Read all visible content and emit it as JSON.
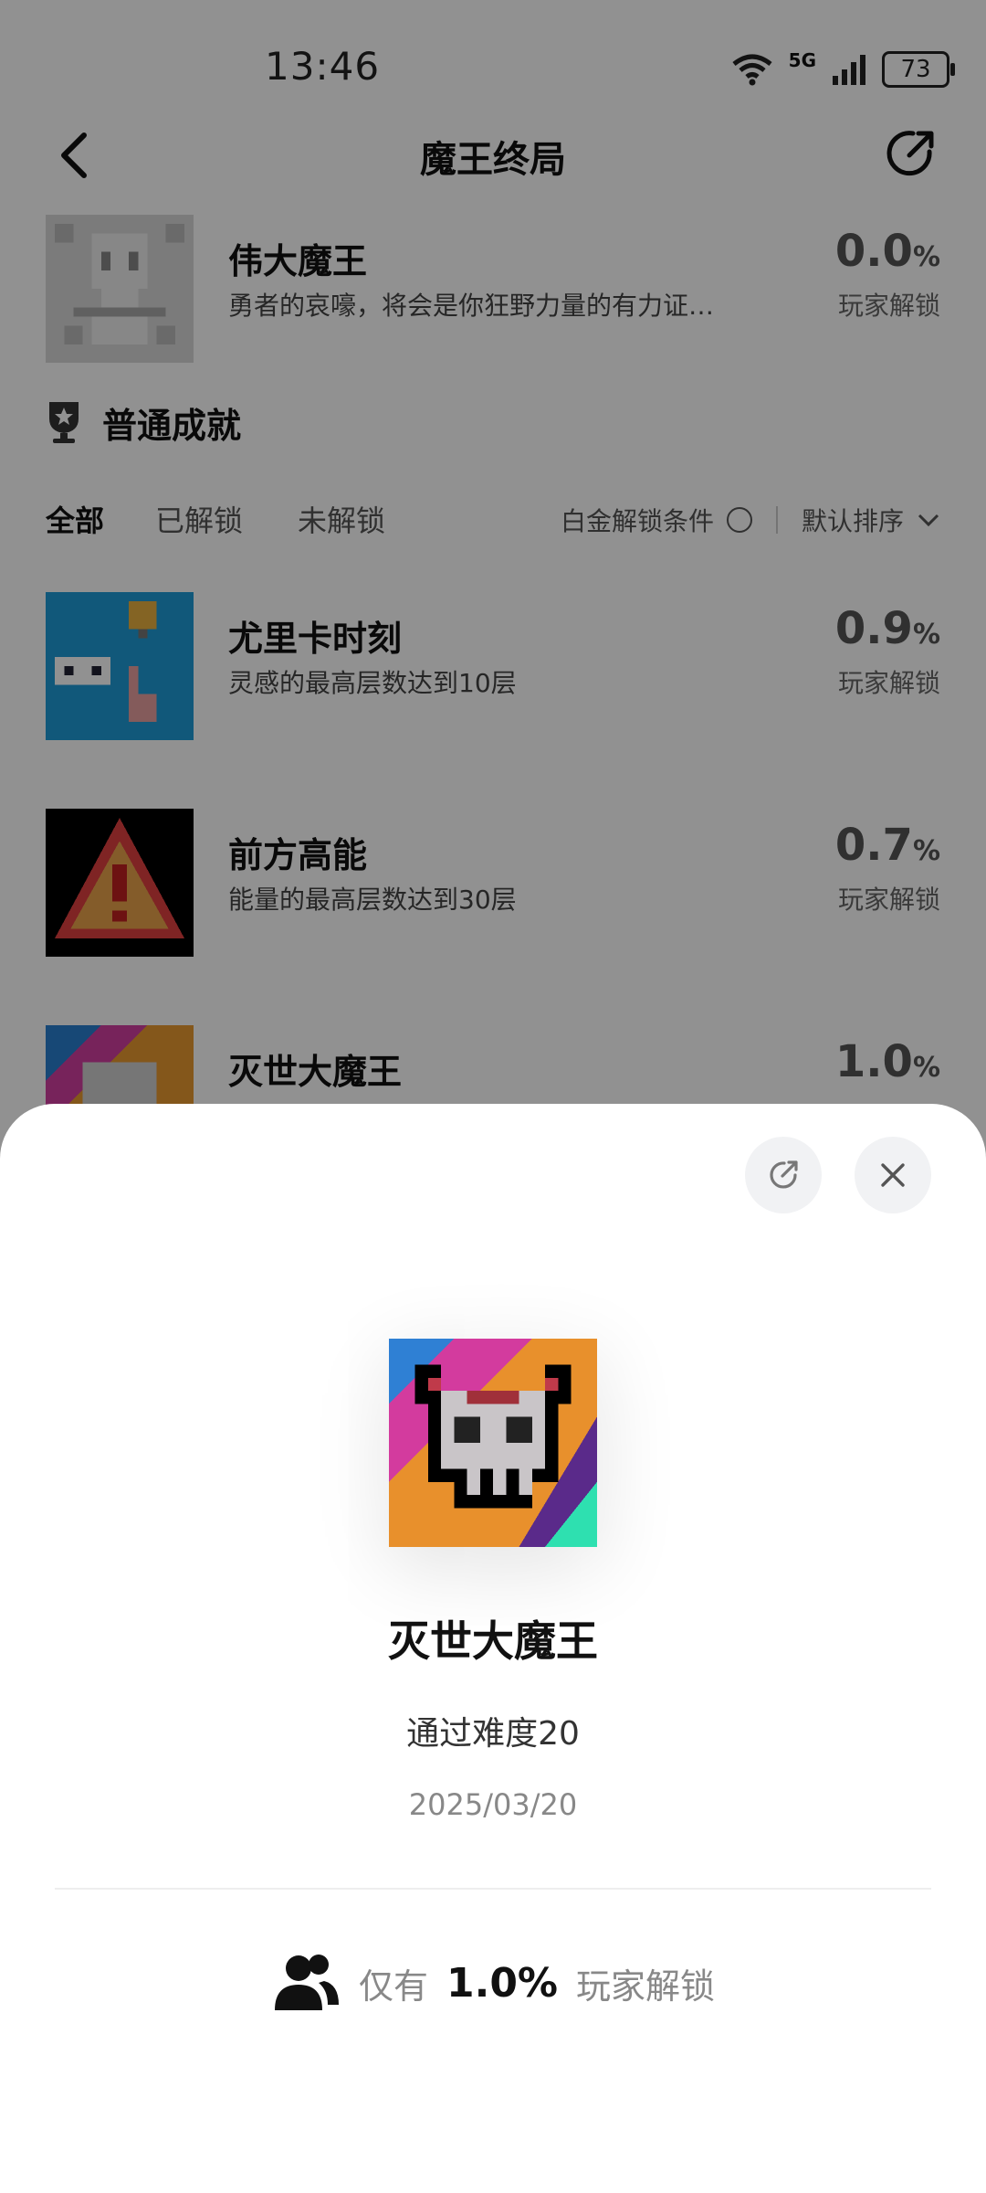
{
  "status": {
    "time": "13:46",
    "network": "5G",
    "battery": "73"
  },
  "header": {
    "title": "魔王终局"
  },
  "top_item": {
    "name": "伟大魔王",
    "desc": "勇者的哀嚎，将会是你狂野力量的有力证…",
    "pct_value": "0.0",
    "pct_unit": "%",
    "pct_label": "玩家解锁"
  },
  "section": {
    "label": "普通成就"
  },
  "filters": {
    "tabs": [
      "全部",
      "已解锁",
      "未解锁"
    ],
    "platinum": "白金解锁条件",
    "sort": "默认排序"
  },
  "items": [
    {
      "name": "尤里卡时刻",
      "desc": "灵感的最高层数达到10层",
      "pct_value": "0.9",
      "pct_unit": "%",
      "pct_label": "玩家解锁"
    },
    {
      "name": "前方高能",
      "desc": "能量的最高层数达到30层",
      "pct_value": "0.7",
      "pct_unit": "%",
      "pct_label": "玩家解锁"
    },
    {
      "name": "灭世大魔王",
      "pct_value": "1.0",
      "pct_unit": "%"
    }
  ],
  "sheet": {
    "title": "灭世大魔王",
    "desc": "通过难度20",
    "date": "2025/03/20",
    "stat_prefix": "仅有",
    "stat_value": "1.0%",
    "stat_suffix": "玩家解锁"
  },
  "icons": [
    "back-icon",
    "share-icon",
    "trophy-icon",
    "chevron-down-icon",
    "close-icon",
    "users-icon",
    "wifi-icon",
    "signal-icon",
    "battery-icon"
  ]
}
